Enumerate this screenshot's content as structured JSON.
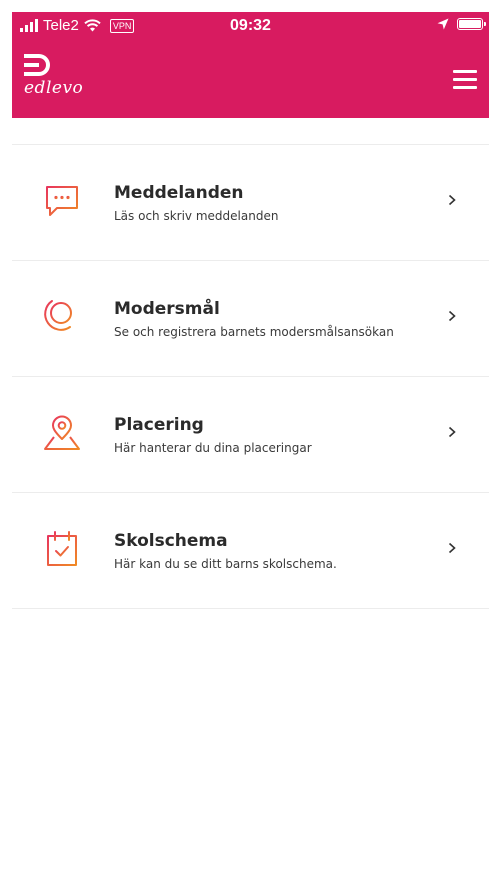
{
  "status_bar": {
    "carrier": "Tele2",
    "vpn": "VPN",
    "time": "09:32"
  },
  "header": {
    "brand": "edlevo",
    "background": "#d81b60"
  },
  "menu": {
    "items": [
      {
        "title": "Meddelanden",
        "subtitle": "Läs och skriv meddelanden",
        "icon": "chat-bubble-icon"
      },
      {
        "title": "Modersmål",
        "subtitle": "Se och registrera barnets modersmålsansökan",
        "icon": "globe-icon"
      },
      {
        "title": "Placering",
        "subtitle": "Här hanterar du dina placeringar",
        "icon": "map-pin-icon"
      },
      {
        "title": "Skolschema",
        "subtitle": "Här kan du se ditt barns skolschema.",
        "icon": "calendar-check-icon"
      }
    ]
  },
  "colors": {
    "icon_gradient_start": "#e8365d",
    "icon_gradient_end": "#f08a24"
  }
}
